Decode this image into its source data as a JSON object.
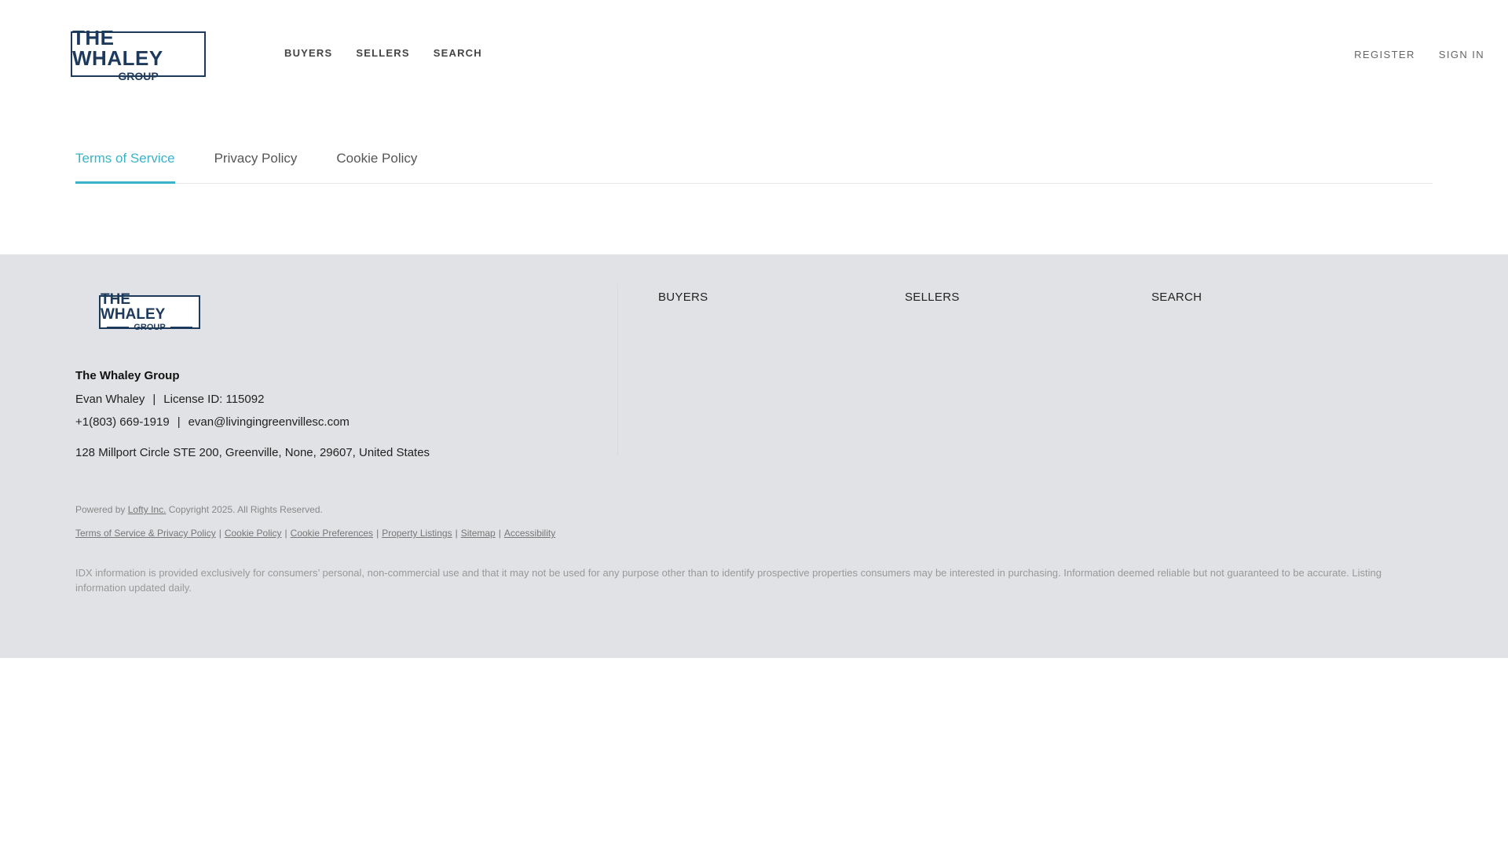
{
  "header": {
    "logo": {
      "line1": "THE WHALEY",
      "line2": "GROUP"
    },
    "nav": [
      "BUYERS",
      "SELLERS",
      "SEARCH"
    ],
    "auth": {
      "register": "REGISTER",
      "sign_in": "SIGN IN"
    }
  },
  "tabs": [
    {
      "label": "Terms of Service",
      "active": true
    },
    {
      "label": "Privacy Policy",
      "active": false
    },
    {
      "label": "Cookie Policy",
      "active": false
    }
  ],
  "footer": {
    "logo": {
      "line1": "THE WHALEY",
      "line2": "GROUP"
    },
    "company_name": "The Whaley Group",
    "agent_name": "Evan Whaley",
    "license": "License ID: 115092",
    "phone": "+1(803) 669-1919",
    "email": "evan@livingingreenvillesc.com",
    "address": "128 Millport Circle STE 200, Greenville, None, 29607, United States",
    "nav": [
      "BUYERS",
      "SELLERS",
      "SEARCH"
    ],
    "powered_prefix": "Powered by",
    "powered_link": "Lofty Inc.",
    "copyright": "Copyright 2025. All Rights Reserved.",
    "legal_links": [
      "Terms of Service & Privacy Policy",
      "Cookie Policy",
      "Cookie Preferences",
      "Property Listings",
      "Sitemap",
      "Accessibility"
    ],
    "idx_text": "IDX information is provided exclusively for consumers’ personal, non-commercial use and that it may not be used for any purpose other than to identify prospective properties consumers may be interested in purchasing. Information deemed reliable but not guaranteed to be accurate. Listing information updated daily."
  },
  "colors": {
    "brand_navy": "#1d3a5c",
    "accent_teal": "#3bb3c8",
    "footer_bg": "#e1e2e5"
  }
}
